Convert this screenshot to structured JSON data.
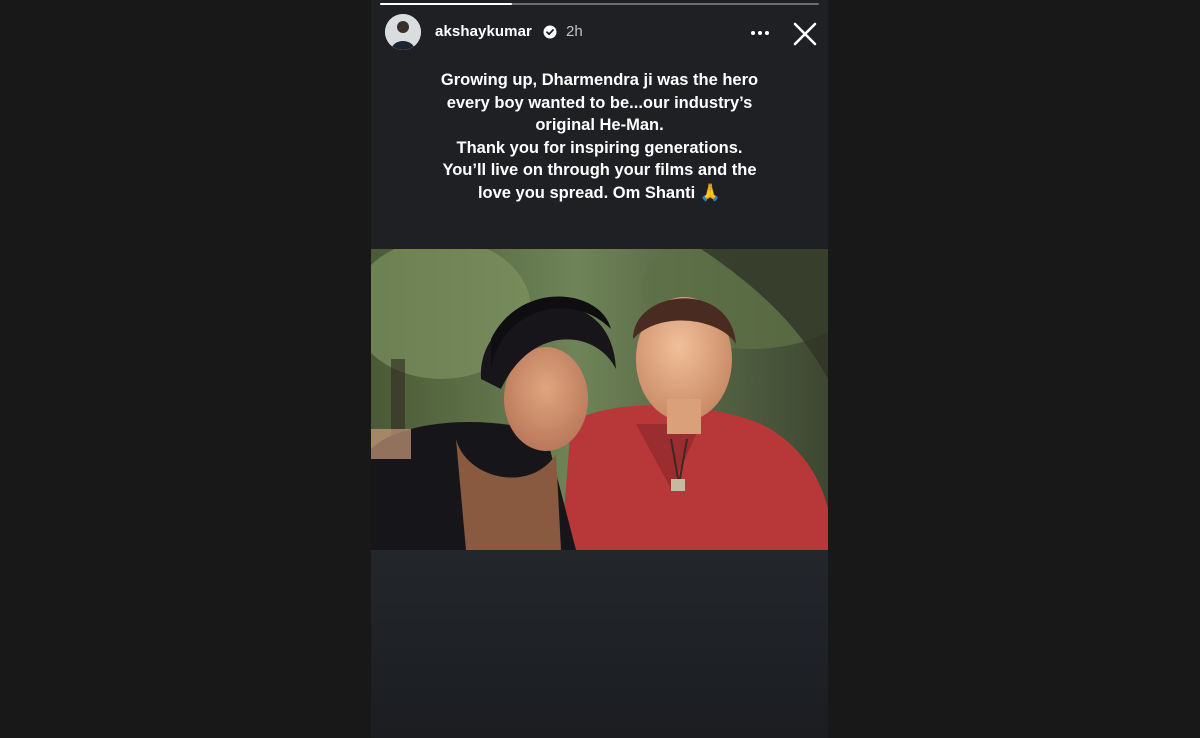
{
  "story": {
    "progress": 0.3,
    "username": "akshaykumar",
    "verified": true,
    "time": "2h",
    "caption_lines": [
      "Growing up, Dharmendra ji was the hero",
      "every boy wanted to be...our industry’s",
      "original He-Man.",
      "Thank you for inspiring generations.",
      "You’ll live on through your films and the",
      "love you spread. Om Shanti"
    ],
    "caption_emoji": "🙏",
    "icons": {
      "more": "more-options-icon",
      "close": "close-icon",
      "verified": "verified-badge-icon"
    }
  },
  "colors": {
    "page_bg": "#181818",
    "story_bg": "#1e2024",
    "text": "#ffffff",
    "muted": "#bfc3c7",
    "verified_blue": "#3897f0"
  }
}
